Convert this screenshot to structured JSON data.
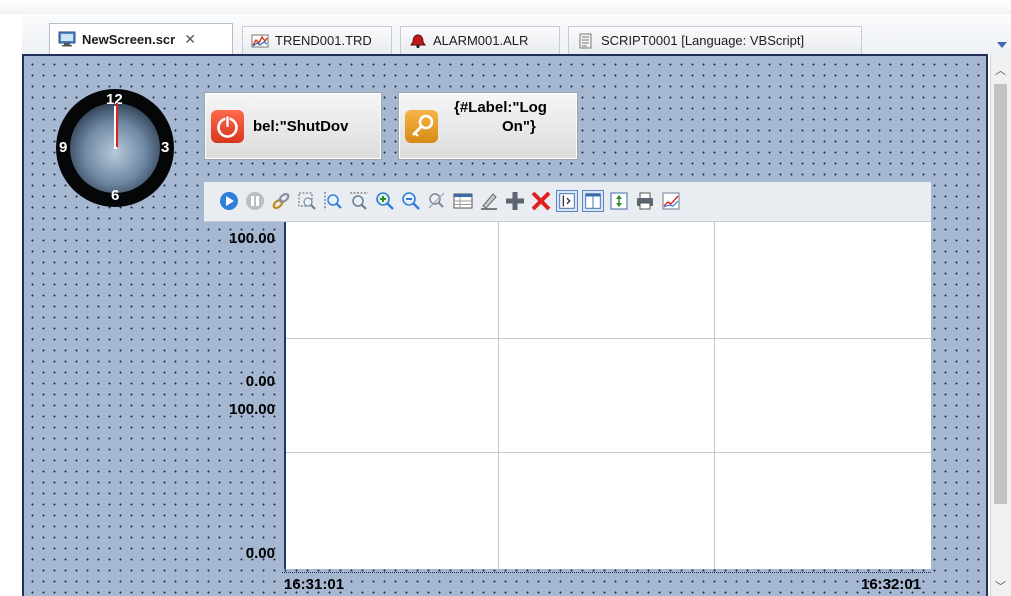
{
  "tabs": [
    {
      "label": "NewScreen.scr",
      "close": "✕",
      "icon": "monitor-icon"
    },
    {
      "label": "TREND001.TRD",
      "icon": "trend-chart-icon"
    },
    {
      "label": "ALARM001.ALR",
      "icon": "alarm-bell-icon"
    },
    {
      "label": "SCRIPT0001 [Language: VBScript]",
      "icon": "script-icon"
    }
  ],
  "clock": {
    "n12": "12",
    "n3": "3",
    "n6": "6",
    "n9": "9"
  },
  "buttons": {
    "shutdown": {
      "label": "bel:\"ShutDov",
      "icon": "power-icon"
    },
    "logon": {
      "line1": "{#Label:\"Log",
      "line2": "On\"}",
      "icon": "key-icon"
    }
  },
  "trend": {
    "toolbar_icons": [
      "play-icon",
      "pause-icon",
      "link-icon",
      "zoom-area-icon",
      "zoom-vertical-icon",
      "zoom-horizontal-icon",
      "zoom-in-icon",
      "zoom-out-icon",
      "zoom-reset-icon",
      "table-icon",
      "pen-icon",
      "add-icon",
      "delete-icon",
      "cursor-icon",
      "legend-icon",
      "scale-icon",
      "print-icon",
      "chart-icon"
    ],
    "y_axis_top": {
      "max": "100.00",
      "min": "0.00"
    },
    "y_axis_bottom": {
      "max": "100.00",
      "min": "0.00"
    },
    "time_start": "16:31:01",
    "time_end": "16:32:01"
  },
  "colors": {
    "canvas_bg": "#a5b7d1",
    "frame": "#1f2f5a",
    "accent": "#3b6aa8"
  }
}
